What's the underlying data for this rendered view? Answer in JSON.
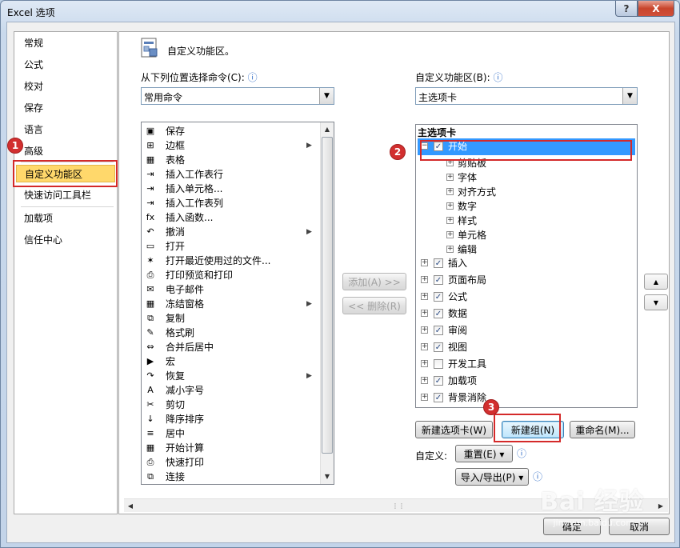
{
  "window": {
    "title": "Excel 选项",
    "help_glyph": "?",
    "close_glyph": "X"
  },
  "nav": {
    "items": [
      {
        "label": "常规"
      },
      {
        "label": "公式"
      },
      {
        "label": "校对"
      },
      {
        "label": "保存"
      },
      {
        "label": "语言"
      },
      {
        "label": "高级"
      },
      {
        "label": "自定义功能区",
        "selected": true
      },
      {
        "label": "快速访问工具栏"
      },
      {
        "label": "加载项"
      },
      {
        "label": "信任中心"
      }
    ]
  },
  "header": {
    "title": "自定义功能区。"
  },
  "left_panel": {
    "label": "从下列位置选择命令(C):",
    "info_glyph": "ⓘ",
    "combo_value": "常用命令",
    "commands": [
      {
        "label": "保存",
        "icon": "save-icon",
        "glyph": "▣"
      },
      {
        "label": "边框",
        "icon": "border-icon",
        "glyph": "⊞",
        "submenu": "▶"
      },
      {
        "label": "表格",
        "icon": "table-icon",
        "glyph": "▦"
      },
      {
        "label": "插入工作表行",
        "icon": "insert-row-icon",
        "glyph": "⇥"
      },
      {
        "label": "插入单元格...",
        "icon": "insert-cell-icon",
        "glyph": "⇥"
      },
      {
        "label": "插入工作表列",
        "icon": "insert-column-icon",
        "glyph": "⇥"
      },
      {
        "label": "插入函数...",
        "icon": "function-icon",
        "glyph": "fx"
      },
      {
        "label": "撤消",
        "icon": "undo-icon",
        "glyph": "↶",
        "submenu": "▶"
      },
      {
        "label": "打开",
        "icon": "open-folder-icon",
        "glyph": "▭"
      },
      {
        "label": "打开最近使用过的文件...",
        "icon": "recent-file-icon",
        "glyph": "✶"
      },
      {
        "label": "打印预览和打印",
        "icon": "print-preview-icon",
        "glyph": "⎙"
      },
      {
        "label": "电子邮件",
        "icon": "email-icon",
        "glyph": "✉"
      },
      {
        "label": "冻结窗格",
        "icon": "freeze-panes-icon",
        "glyph": "▦",
        "submenu": "▶"
      },
      {
        "label": "复制",
        "icon": "copy-icon",
        "glyph": "⧉"
      },
      {
        "label": "格式刷",
        "icon": "format-painter-icon",
        "glyph": "✎"
      },
      {
        "label": "合并后居中",
        "icon": "merge-center-icon",
        "glyph": "⇔"
      },
      {
        "label": "宏",
        "icon": "macro-icon",
        "glyph": "▶"
      },
      {
        "label": "恢复",
        "icon": "redo-icon",
        "glyph": "↷",
        "submenu": "▶"
      },
      {
        "label": "减小字号",
        "icon": "decrease-font-icon",
        "glyph": "A"
      },
      {
        "label": "剪切",
        "icon": "cut-icon",
        "glyph": "✂"
      },
      {
        "label": "降序排序",
        "icon": "sort-desc-icon",
        "glyph": "↓"
      },
      {
        "label": "居中",
        "icon": "center-align-icon",
        "glyph": "≡"
      },
      {
        "label": "开始计算",
        "icon": "calculate-icon",
        "glyph": "▦"
      },
      {
        "label": "快速打印",
        "icon": "quick-print-icon",
        "glyph": "⎙"
      },
      {
        "label": "连接",
        "icon": "connections-icon",
        "glyph": "⧉"
      }
    ]
  },
  "middle": {
    "add_label": "添加(A) >>",
    "remove_label": "<< 删除(R)"
  },
  "right_panel": {
    "label": "自定义功能区(B):",
    "info_glyph": "ⓘ",
    "combo_value": "主选项卡",
    "tree_header": "主选项卡",
    "tabs": [
      {
        "label": "开始",
        "checked": true,
        "expanded": true,
        "selected": true,
        "groups": [
          "剪贴板",
          "字体",
          "对齐方式",
          "数字",
          "样式",
          "单元格",
          "编辑"
        ]
      },
      {
        "label": "插入",
        "checked": true
      },
      {
        "label": "页面布局",
        "checked": true
      },
      {
        "label": "公式",
        "checked": true
      },
      {
        "label": "数据",
        "checked": true
      },
      {
        "label": "审阅",
        "checked": true
      },
      {
        "label": "视图",
        "checked": true
      },
      {
        "label": "开发工具",
        "checked": false
      },
      {
        "label": "加载项",
        "checked": true
      },
      {
        "label": "背景消除",
        "checked": true
      }
    ],
    "new_tab_label": "新建选项卡(W)",
    "new_group_label": "新建组(N)",
    "rename_label": "重命名(M)...",
    "customize_label": "自定义:",
    "reset_label": "重置(E) ▾",
    "import_export_label": "导入/导出(P) ▾"
  },
  "annotations": [
    "1",
    "2",
    "3"
  ],
  "footer": {
    "ok_label": "确定",
    "cancel_label": "取消"
  },
  "watermark": {
    "text": "Bai 经验",
    "sub": "jingyan.baidu.com"
  }
}
